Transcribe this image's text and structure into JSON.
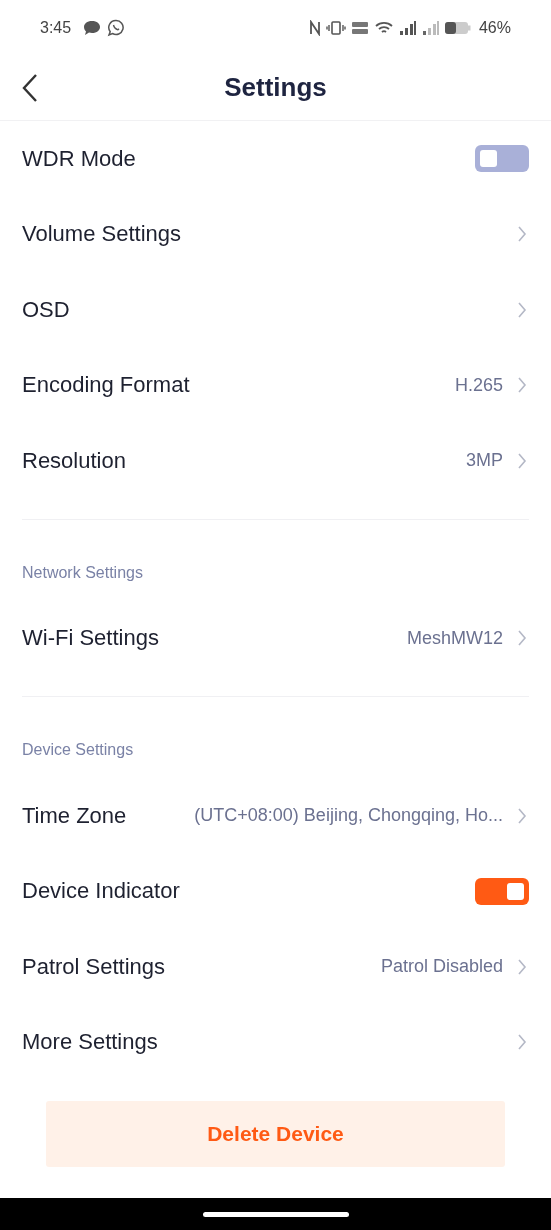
{
  "status_bar": {
    "time": "3:45",
    "battery_text": "46%"
  },
  "header": {
    "title": "Settings"
  },
  "sections": [
    {
      "items": [
        {
          "kind": "toggle",
          "label": "WDR Mode",
          "on": false
        },
        {
          "kind": "link",
          "label": "Volume Settings"
        },
        {
          "kind": "link",
          "label": "OSD"
        },
        {
          "kind": "link",
          "label": "Encoding Format",
          "value": "H.265"
        },
        {
          "kind": "link",
          "label": "Resolution",
          "value": "3MP"
        }
      ]
    },
    {
      "label": "Network Settings",
      "items": [
        {
          "kind": "link",
          "label": "Wi-Fi Settings",
          "value": "MeshMW12"
        }
      ]
    },
    {
      "label": "Device Settings",
      "items": [
        {
          "kind": "link",
          "label": "Time Zone",
          "value": "(UTC+08:00) Beijing, Chongqing, Ho..."
        },
        {
          "kind": "toggle",
          "label": "Device Indicator",
          "on": true
        },
        {
          "kind": "link",
          "label": "Patrol Settings",
          "value": "Patrol Disabled"
        },
        {
          "kind": "link",
          "label": "More Settings"
        }
      ]
    }
  ],
  "delete_button": "Delete Device"
}
